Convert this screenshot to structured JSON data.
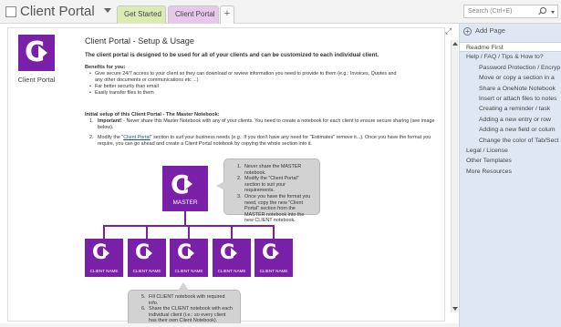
{
  "notebook": {
    "title": "Client Portal"
  },
  "tabs": [
    {
      "label": "Get Started"
    },
    {
      "label": "Client Portal"
    },
    {
      "label": "+"
    }
  ],
  "search": {
    "placeholder": "Search (Ctrl+E)"
  },
  "page": {
    "side_logo_label": "Client Portal",
    "title": "Client Portal - Setup & Usage",
    "intro": "The client portal is designed to be used for all of your clients and can be customized to each individual client.",
    "benefits_heading": "Benefits for you:",
    "benefits": [
      "Give secure 24/7 access to your client so they can download or review information you need to provide to them (e.g.: Invoices, Quotes and any other documents or communications etc ...)",
      "Far better security than email",
      "Easily transfer files to them"
    ],
    "setup_heading": "Initial setup of this Client Portal - The Master Notebook:",
    "steps": [
      {
        "num": "1.",
        "lead": "Important!",
        "text": " - Never share this Master Notebook with any of your clients. You need to create a notebook for each client to ensure secure sharing (see image below)."
      },
      {
        "num": "2.",
        "pre": "Modify the \"",
        "link": "Client Portal",
        "text": "\" section to suit your business needs (e.g.: If you don't have any need for \"Estimates\" remove it...). Once you have the format you require, you can go ahead and create a Client Portal notebook by copying the whole section into it."
      }
    ],
    "master_label": "MASTER",
    "client_label": "CLIENT NAME",
    "callout_top": [
      {
        "n": "1.",
        "t": "Never share the MASTER notebook."
      },
      {
        "n": "2.",
        "t": "Modify the \"Client Portal\" section to suit your requirements."
      },
      {
        "n": "3.",
        "t": "Once you have the format you need, copy the new \"Client Portal\" section from the MASTER notebook into the new CLIENT notebook."
      }
    ],
    "callout_bottom": [
      {
        "n": "5.",
        "t": "Fill CLIENT notebook with required info."
      },
      {
        "n": "6.",
        "t": "Share the CLIENT notebook with each individual client (i.e.: so every client has their own Client Notebook)."
      }
    ]
  },
  "right_pane": {
    "add_page": "Add Page",
    "pages": [
      {
        "label": "Readme First",
        "level": 0,
        "active": true
      },
      {
        "label": "Help / FAQ / Tips & How to?",
        "level": 0
      },
      {
        "label": "Password Protection / Encryp",
        "level": 1
      },
      {
        "label": "Move or copy a section in a",
        "level": 1
      },
      {
        "label": "Share a OneNote Notebook",
        "level": 1
      },
      {
        "label": "Insert or attach files to notes",
        "level": 1
      },
      {
        "label": "Creating a reminder / task",
        "level": 1
      },
      {
        "label": "Adding a new entry or row",
        "level": 1
      },
      {
        "label": "Adding a new field or colum",
        "level": 1
      },
      {
        "label": "Change the color of Tab/Sect",
        "level": 1
      },
      {
        "label": "Legal / License",
        "level": 0
      },
      {
        "label": "Other Templates",
        "level": 0
      },
      {
        "label": "More Resources",
        "level": 0
      }
    ]
  },
  "colors": {
    "accent": "#7a1fa8",
    "tab_get_started": "#dcebb3",
    "tab_client_portal": "#e8c8ea",
    "pane": "#dfe7f3"
  }
}
